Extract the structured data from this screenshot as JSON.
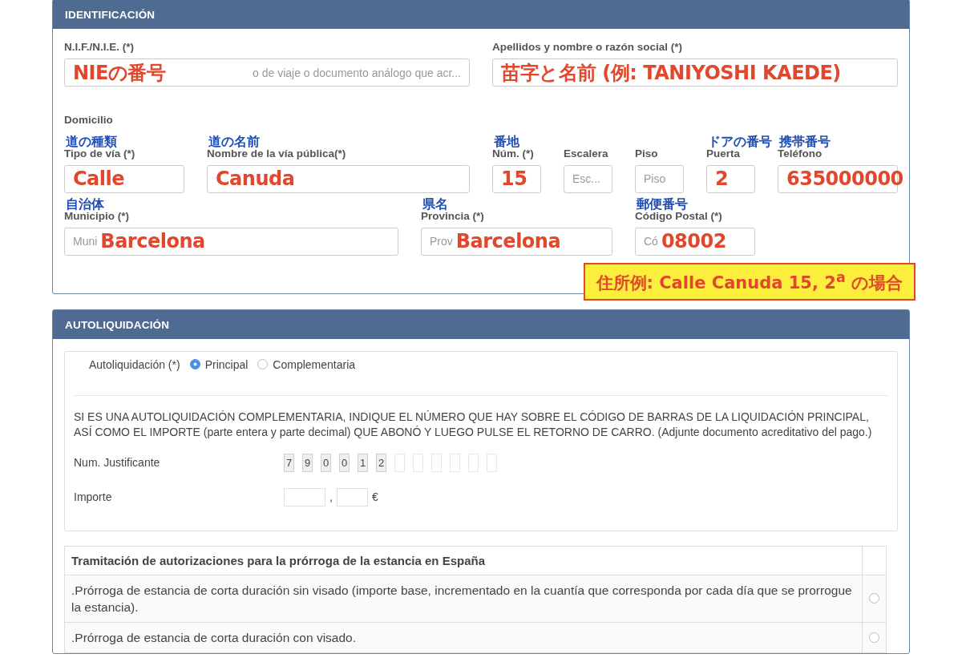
{
  "identification": {
    "title": "IDENTIFICACIÓN",
    "row_1": [
      {
        "label": "N.I.F./N.I.E. (*)",
        "parts": [
          {
            "kind": "note",
            "text": "NIEの番号"
          },
          {
            "kind": "placeholder",
            "text": "o de viaje o documento análogo que acr..."
          }
        ]
      },
      {
        "label": "Apellidos y nombre o razón social (*)",
        "parts": [
          {
            "kind": "note",
            "text": "苗字と名前 (例: TANIYOSHI KAEDE)"
          }
        ]
      }
    ],
    "address_title": "Domicilio",
    "row_2": [
      {
        "note": "道の種類",
        "label": "Tipo de vía (*)",
        "parts": [
          {
            "kind": "note",
            "text": "Calle"
          }
        ]
      },
      {
        "note": "道の名前",
        "label": "Nombre de la vía pública(*)",
        "parts": [
          {
            "kind": "note",
            "text": "Canuda"
          }
        ]
      },
      {
        "note": "番地",
        "label": "Núm. (*)",
        "parts": [
          {
            "kind": "note",
            "text": "15"
          }
        ]
      },
      {
        "label": "Escalera",
        "parts": [
          {
            "kind": "placeholder",
            "text": "Esc..."
          }
        ]
      },
      {
        "label": "Piso",
        "parts": [
          {
            "kind": "placeholder",
            "text": "Piso"
          }
        ]
      },
      {
        "note": "ドアの番号",
        "label": "Puerta",
        "parts": [
          {
            "kind": "note",
            "text": "2"
          }
        ]
      },
      {
        "note": "携帯番号",
        "label": "Teléfono",
        "parts": [
          {
            "kind": "note",
            "text": "635000000"
          }
        ]
      }
    ],
    "row_3": [
      {
        "note": "自治体",
        "label": "Municipio (*)",
        "parts": [
          {
            "kind": "placeholder",
            "text": "Muni"
          },
          {
            "kind": "note",
            "text": "Barcelona"
          }
        ]
      },
      {
        "note": "県名",
        "label": "Provincia (*)",
        "parts": [
          {
            "kind": "placeholder",
            "text": "Prov"
          },
          {
            "kind": "note",
            "text": "Barcelona"
          }
        ]
      },
      {
        "note": "郵便番号",
        "label": "Código Postal (*)",
        "parts": [
          {
            "kind": "placeholder",
            "text": "Có"
          },
          {
            "kind": "note",
            "text": "08002"
          }
        ]
      }
    ],
    "callout": "住所例: Calle Canuda 15, 2$^{a}$ の場合"
  },
  "self_assessment": {
    "title": "AUTOLIQUIDACIÓN",
    "radio_label": "Autoliquidación (*)",
    "options": [
      {
        "label": "Principal",
        "selected": true
      },
      {
        "label": "Complementaria",
        "selected": false
      }
    ],
    "instructions": "SI ES UNA AUTOLIQUIDACIÓN COMPLEMENTARIA, INDIQUE EL NÚMERO QUE HAY SOBRE EL CÓDIGO DE BARRAS DE LA LIQUIDACIÓN PRINCIPAL, ASÍ COMO EL IMPORTE (parte entera y parte decimal) QUE ABONÓ Y LUEGO PULSE EL RETORNO DE CARRO. (Adjunte documento acreditativo del pago.)",
    "receipt_label": "Num. Justificante",
    "receipt_boxes": [
      {
        "filled": true,
        "digit": "7"
      },
      {
        "filled": true,
        "digit": "9"
      },
      {
        "filled": true,
        "digit": "0"
      },
      {
        "filled": true,
        "digit": "0"
      },
      {
        "filled": true,
        "digit": "1"
      },
      {
        "filled": true,
        "digit": "2"
      },
      {
        "filled": false
      },
      {
        "filled": false
      },
      {
        "filled": false
      },
      {
        "filled": false
      },
      {
        "filled": false
      },
      {
        "filled": false
      }
    ],
    "amount_label": "Importe",
    "amount_separator": ",",
    "currency": "€",
    "table": {
      "heading": "Tramitación de autorizaciones para la prórroga de la estancia en España",
      "rows": [
        {
          "text": ".Prórroga de estancia de corta duración sin visado (importe base, incrementado en la cuantía que corresponda por cada día que se prorrogue la estancia).",
          "selected": false
        },
        {
          "text": ".Prórroga de estancia de corta duración con visado.",
          "selected": false
        }
      ]
    }
  }
}
